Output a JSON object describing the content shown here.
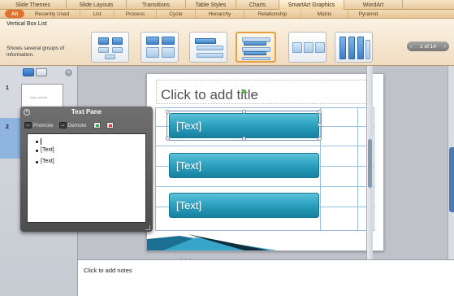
{
  "ribbon_tabs": [
    "Slide Themes",
    "Slide Layouts",
    "Transitions",
    "Table Styles",
    "Charts",
    "SmartArt Graphics",
    "WordArt"
  ],
  "active_tab": "SmartArt Graphics",
  "categories": [
    "All",
    "Recently Used",
    "List",
    "Process",
    "Cycle",
    "Hierarchy",
    "Relationship",
    "Matrix",
    "Pyramid"
  ],
  "gallery": {
    "selected_name": "Vertical Box List",
    "selected_description": "Shows several groups of information.",
    "page_indicator": "1 of 14",
    "prev_icon": "‹",
    "next_icon": "›"
  },
  "slides_panel": {
    "slide_numbers": [
      "1",
      "2"
    ],
    "close_icon": "×",
    "thumb_text": "Click to add title"
  },
  "slide": {
    "title_placeholder": "Click to add title",
    "boxes": [
      "[Text]",
      "[Text]",
      "[Text]"
    ]
  },
  "text_pane": {
    "title": "Text Pane",
    "close_icon": "×",
    "promote_label": "Promote",
    "demote_label": "Demote",
    "promote_icon": "←",
    "demote_icon": "→",
    "items": [
      "",
      "[Text]",
      "[Text]"
    ]
  },
  "notes": {
    "placeholder": "Click to add notes",
    "grip": "• • •"
  },
  "colors": {
    "accent": "#e0722f",
    "smartart_box": "#2ea2c1",
    "selected_border": "#e4a043"
  }
}
